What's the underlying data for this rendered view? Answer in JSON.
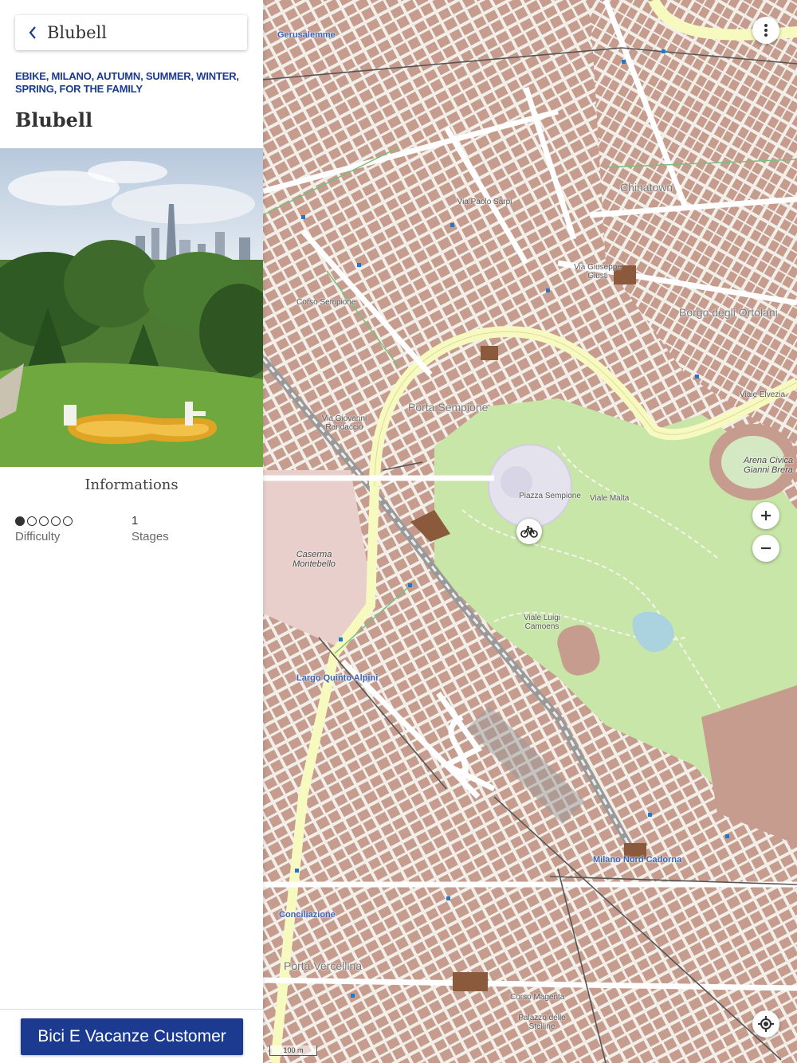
{
  "header": {
    "back_icon": "chevron-left-icon",
    "title": "Blubell"
  },
  "route": {
    "tags": "EBIKE, MILANO, AUTUMN, SUMMER, WINTER, SPRING, FOR THE FAMILY",
    "title": "Blubell"
  },
  "informations": {
    "section_title": "Informations",
    "difficulty_label": "Difficulty",
    "difficulty_level": 1,
    "difficulty_max": 5,
    "stages_value": "1",
    "stages_label": "Stages"
  },
  "footer": {
    "button_label": "Bici E Vacanze Customer"
  },
  "map": {
    "scale_label": "100 m",
    "marker_icon": "bicycle-icon",
    "menu_icon": "more-vertical-icon",
    "zoom_in_icon": "plus-icon",
    "zoom_out_icon": "minus-icon",
    "locate_icon": "locate-icon",
    "labels": [
      {
        "text": "Gerusalemme",
        "cls": "blue"
      },
      {
        "text": "Porta Sempione",
        "cls": "big"
      },
      {
        "text": "Piazza Sempione",
        "cls": ""
      },
      {
        "text": "Chinatown",
        "cls": "big"
      },
      {
        "text": "Borgo degli Ortolani",
        "cls": "big"
      },
      {
        "text": "Arena Civica Gianni Brera",
        "cls": "ital"
      },
      {
        "text": "Caserma Montebello",
        "cls": "ital"
      },
      {
        "text": "Milano Nord Cadorna",
        "cls": "blue"
      },
      {
        "text": "Conciliazione",
        "cls": "blue"
      },
      {
        "text": "Porta Vercellina",
        "cls": "big"
      },
      {
        "text": "Palazzo delle Stelline",
        "cls": ""
      },
      {
        "text": "Corso Sempione",
        "cls": ""
      },
      {
        "text": "Via Paolo Sarpi",
        "cls": ""
      },
      {
        "text": "Viale Elvezia",
        "cls": ""
      },
      {
        "text": "Viale Luigi Camoens",
        "cls": ""
      },
      {
        "text": "Corso Magenta",
        "cls": ""
      },
      {
        "text": "Via Giuseppe Giusti",
        "cls": ""
      },
      {
        "text": "Largo Quinto Alpini",
        "cls": "blue"
      },
      {
        "text": "Viale Malta",
        "cls": ""
      },
      {
        "text": "Via Giovanni Randaccio",
        "cls": ""
      }
    ]
  },
  "colors": {
    "accent": "#1c3a8f",
    "map_background": "#f2efe9",
    "building": "#c59c8e",
    "park": "#c8e6a7",
    "major_road": "#f7fabf"
  }
}
